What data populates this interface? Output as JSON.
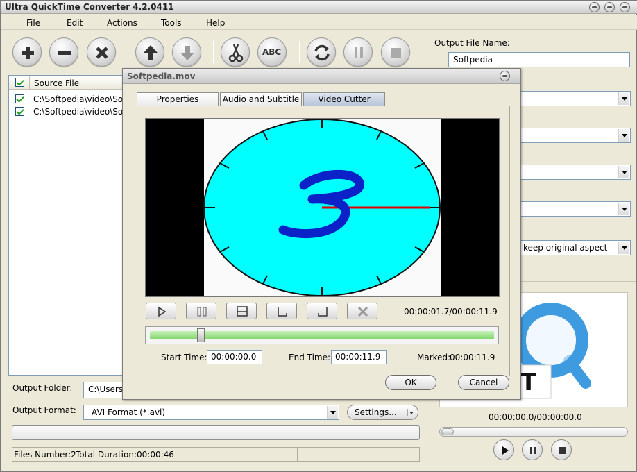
{
  "window": {
    "title": "Ultra QuickTime Converter 4.2.0411"
  },
  "menu": [
    "File",
    "Edit",
    "Actions",
    "Tools",
    "Help"
  ],
  "toolbar": {
    "buttons": [
      "add-icon",
      "remove-icon",
      "clear-icon",
      "move-up-icon",
      "move-down-icon",
      "cut-icon",
      "rename-icon",
      "convert-icon",
      "pause-icon",
      "stop-icon"
    ],
    "rename_label": "ABC"
  },
  "file_list": {
    "header": "Source File",
    "rows": [
      {
        "checked": true,
        "path": "C:\\Softpedia\\video\\Soft"
      },
      {
        "checked": true,
        "path": "C:\\Softpedia\\video\\Soft"
      }
    ]
  },
  "output": {
    "folder_label": "Output Folder:",
    "folder_value": "C:\\Users",
    "format_label": "Output Format:",
    "format_value": "AVI Format (*.avi)",
    "settings_label": "Settings..."
  },
  "status": {
    "files": "Files Number:2",
    "duration": "Total Duration:00:00:46"
  },
  "right_panel": {
    "output_name_label": "Output File Name:",
    "output_name_value": "Softpedia",
    "aspect_value": "keep original aspect",
    "time_display": "00:00:00.0/00:00:00.0"
  },
  "dialog": {
    "title": "Softpedia.mov",
    "tabs": [
      "Properties",
      "Audio and Subtitle",
      "Video Cutter"
    ],
    "active_tab": "Video Cutter",
    "time_display": "00:00:01.7/00:00:11.9",
    "start_label": "Start Time:",
    "start_value": "00:00:00.0",
    "end_label": "End Time:",
    "end_value": "00:00:11.9",
    "marked_label": "Marked:",
    "marked_value": "00:00:11.9",
    "seek_position": 0.14,
    "ok_label": "OK",
    "cancel_label": "Cancel"
  },
  "colors": {
    "window_bg": "#ece9d8",
    "clock_face": "#00ffff",
    "clock_digit": "#0a22c8",
    "clock_hand": "#e00000",
    "seek_fill": "#8fdc78"
  }
}
